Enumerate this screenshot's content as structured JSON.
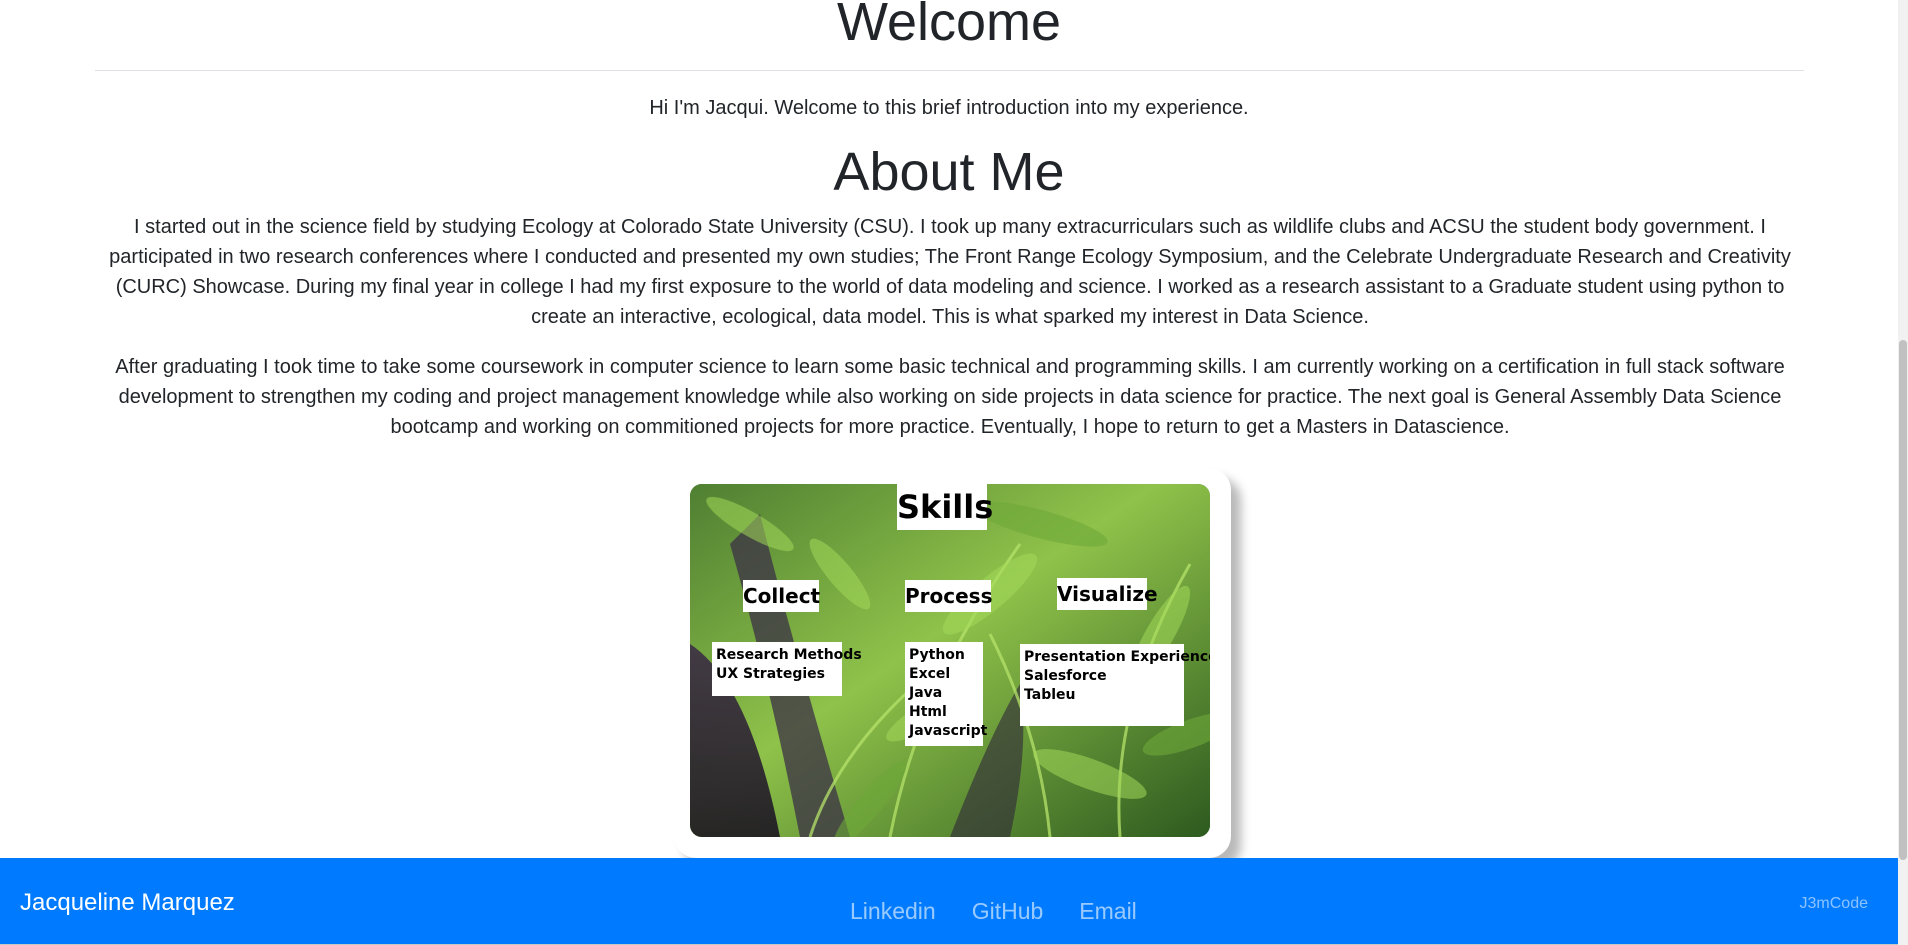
{
  "welcome": {
    "heading": "Welcome",
    "intro": "Hi I'm Jacqui. Welcome to this brief introduction into my experience."
  },
  "about": {
    "heading": "About Me",
    "paragraphs": [
      "I started out in the science field by studying Ecology at Colorado State University (CSU). I took up many extracurriculars such as wildlife clubs and ACSU the student body government. I participated in two research conferences where I conducted and presented my own studies; The Front Range Ecology Symposium, and the Celebrate Undergraduate Research and Creativity (CURC) Showcase. During my final year in college I had my first exposure to the world of data modeling and science. I worked as a research assistant to a Graduate student using python to create an interactive, ecological, data model. This is what sparked my interest in Data Science.",
      "After graduating I took time to take some coursework in computer science to learn some basic technical and programming skills. I am currently working on a certification in full stack software development to strengthen my coding and project management knowledge while also working on side projects in data science for practice. The next goal is General Assembly Data Science bootcamp and working on commitioned projects for more practice. Eventually, I hope to return to get a Masters in Datascience."
    ]
  },
  "skills": {
    "title": "Skills",
    "collect": {
      "heading": "Collect",
      "items": [
        "Research Methods",
        "UX Strategies"
      ]
    },
    "process": {
      "heading": "Process",
      "items": [
        "Python",
        "Excel",
        "Java",
        "Html",
        "Javascript"
      ]
    },
    "visualize": {
      "heading": "Visualize",
      "items": [
        "Presentation Experience",
        "Salesforce",
        "Tableu"
      ]
    }
  },
  "footer": {
    "brand": "Jacqueline Marquez",
    "links": [
      "Linkedin",
      "GitHub",
      "Email"
    ],
    "right": "J3mCode"
  },
  "colors": {
    "footer_bg": "#007bff",
    "text": "#212529",
    "rule": "#dee2e6"
  }
}
